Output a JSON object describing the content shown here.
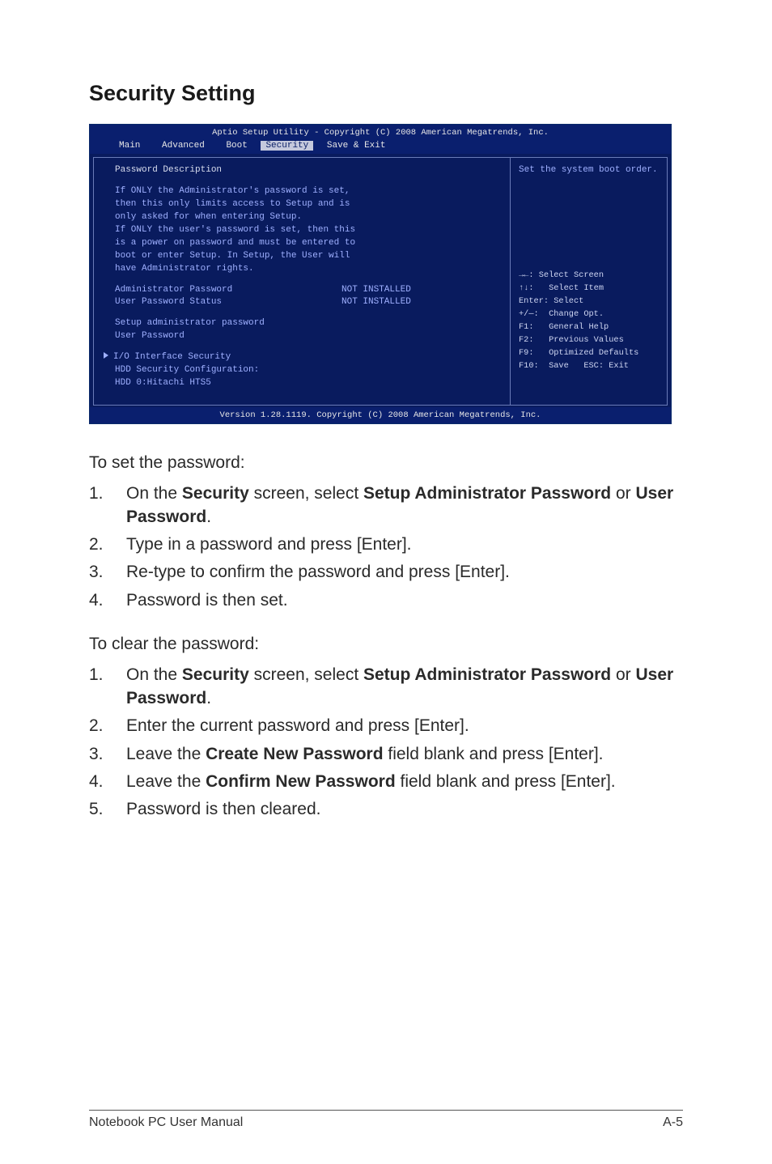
{
  "heading": "Security Setting",
  "bios": {
    "titlebar": "Aptio Setup Utility - Copyright (C) 2008 American Megatrends, Inc.",
    "tabs": [
      "Main",
      "Advanced",
      "Boot",
      "Security",
      "Save & Exit"
    ],
    "active_tab_index": 3,
    "left": {
      "pd_heading": "Password Description",
      "desc_lines": [
        "If ONLY the Administrator's password is set,",
        "then this only limits access to Setup and is",
        "only asked for when entering Setup.",
        "If ONLY the user's password is set, then this",
        "is a power on password and must be entered to",
        "boot or enter Setup. In Setup, the User will",
        "have Administrator rights."
      ],
      "pairs": [
        {
          "k": "Administrator Password",
          "v": "NOT INSTALLED"
        },
        {
          "k": "User Password Status",
          "v": "NOT INSTALLED"
        }
      ],
      "items": [
        "Setup administrator password",
        "User Password"
      ],
      "io_item": "I/O Interface Security",
      "hdd_lines": [
        "HDD Security Configuration:",
        "HDD 0:Hitachi HTS5"
      ]
    },
    "right": {
      "topmsg": "Set the system boot order.",
      "help_lines": [
        "→←: Select Screen",
        "↑↓:   Select Item",
        "Enter: Select",
        "+/—:  Change Opt.",
        "F1:   General Help",
        "F2:   Previous Values",
        "F9:   Optimized Defaults",
        "F10:  Save   ESC: Exit"
      ]
    },
    "footer": "Version 1.28.1119. Copyright (C) 2008 American Megatrends, Inc."
  },
  "doc": {
    "set_lead": "To set the password:",
    "set_steps": [
      {
        "n": "1.",
        "pre": "On the ",
        "b1": "Security",
        "mid": " screen, select ",
        "b2": "Setup Administrator Password",
        "post1": " or ",
        "b3": "User Password",
        "post2": "."
      },
      {
        "n": "2.",
        "plain": "Type in a password and press [Enter]."
      },
      {
        "n": "3.",
        "plain": "Re-type to confirm the password and press [Enter]."
      },
      {
        "n": "4.",
        "plain": "Password is then set."
      }
    ],
    "clear_lead": "To clear the password:",
    "clear_steps": [
      {
        "n": "1.",
        "pre": "On the ",
        "b1": "Security",
        "mid": " screen, select ",
        "b2": "Setup Administrator Password",
        "post1": " or ",
        "b3": "User Password",
        "post2": "."
      },
      {
        "n": "2.",
        "plain": "Enter the current password and press [Enter]."
      },
      {
        "n": "3.",
        "pre": "Leave the ",
        "b1": "Create New Password",
        "post2": " field blank and press [Enter]."
      },
      {
        "n": "4.",
        "pre": "Leave the ",
        "b1": "Confirm New Password",
        "post2": " field blank and press [Enter]."
      },
      {
        "n": "5.",
        "plain": "Password is then cleared."
      }
    ]
  },
  "footer": {
    "left": "Notebook PC User Manual",
    "right": "A-5"
  }
}
